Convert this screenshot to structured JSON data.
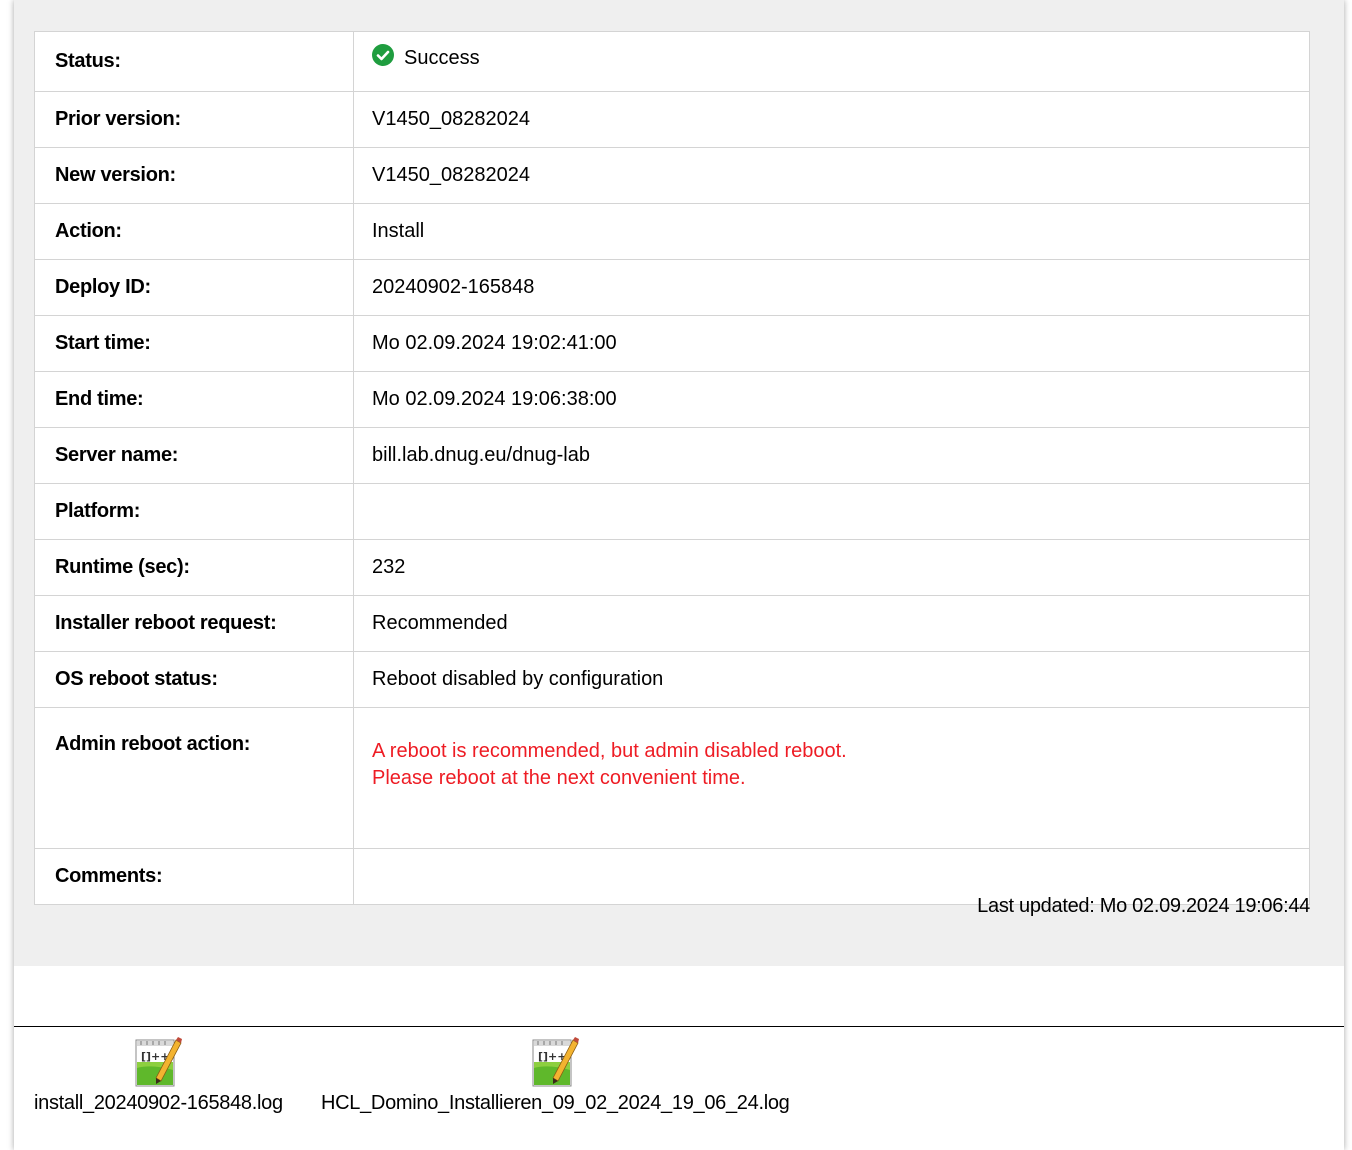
{
  "details": {
    "status_label": "Status:",
    "status_value": "Success",
    "status_icon": "check-circle-icon",
    "status_color": "#1f9d3f",
    "rows": [
      {
        "label": "Prior version:",
        "value": "V1450_08282024"
      },
      {
        "label": "New version:",
        "value": "V1450_08282024"
      },
      {
        "label": "Action:",
        "value": "Install"
      },
      {
        "label": "Deploy ID:",
        "value": "20240902-165848"
      },
      {
        "label": "Start time:",
        "value": "Mo 02.09.2024 19:02:41:00"
      },
      {
        "label": "End time:",
        "value": "Mo 02.09.2024 19:06:38:00"
      },
      {
        "label": "Server name:",
        "value": "bill.lab.dnug.eu/dnug-lab"
      },
      {
        "label": "Platform:",
        "value": ""
      },
      {
        "label": "Runtime (sec):",
        "value": "232"
      },
      {
        "label": "Installer reboot request:",
        "value": "Recommended"
      },
      {
        "label": "OS reboot status:",
        "value": "Reboot disabled by configuration"
      }
    ],
    "admin_reboot_label": "Admin reboot action:",
    "admin_reboot_line1": "A reboot is recommended, but admin disabled reboot.",
    "admin_reboot_line2": "Please reboot at the next convenient time.",
    "warning_color": "#ee1c24",
    "comments_label": "Comments:",
    "comments_value": ""
  },
  "last_updated": "Last updated: Mo 02.09.2024 19:06:44",
  "attachments": [
    {
      "name": "install_20240902-165848.log",
      "icon": "notepad-plus-plus-icon"
    },
    {
      "name": "HCL_Domino_Installieren_09_02_2024_19_06_24.log",
      "icon": "notepad-plus-plus-icon"
    }
  ]
}
